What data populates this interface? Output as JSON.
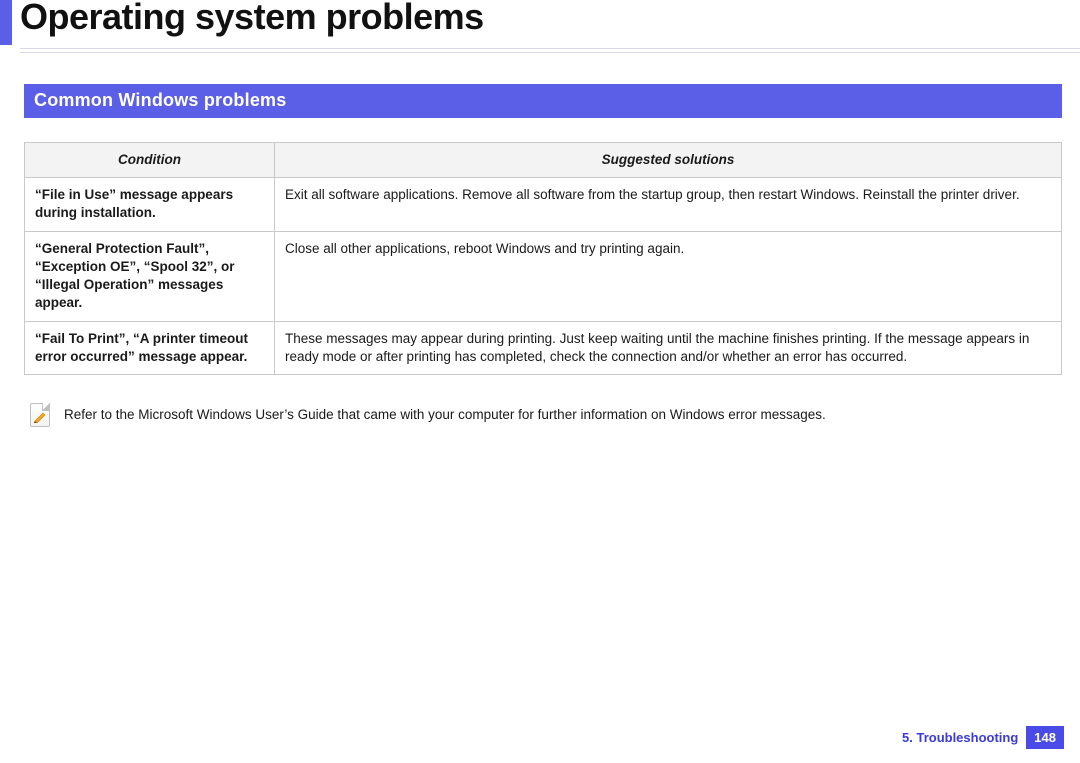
{
  "title": "Operating system problems",
  "section": "Common Windows problems",
  "table": {
    "headers": {
      "condition": "Condition",
      "solution": "Suggested solutions"
    },
    "rows": [
      {
        "condition": "“File in Use” message appears during installation.",
        "solution": "Exit all software applications. Remove all software from the startup group, then restart Windows. Reinstall the printer driver."
      },
      {
        "condition": "“General Protection Fault”, “Exception OE”, “Spool 32”, or “Illegal Operation” messages appear.",
        "solution": "Close all other applications, reboot Windows and try printing again."
      },
      {
        "condition": "“Fail To Print”, “A printer timeout error occurred” message appear.",
        "solution": "These messages may appear during printing. Just keep waiting until the machine finishes printing. If the message appears in ready mode or after printing has completed, check the connection and/or whether an error has occurred."
      }
    ]
  },
  "note": "Refer to the Microsoft Windows User’s Guide that came with your computer for further information on Windows error messages.",
  "footer": {
    "chapter": "5.  Troubleshooting",
    "page": "148"
  }
}
